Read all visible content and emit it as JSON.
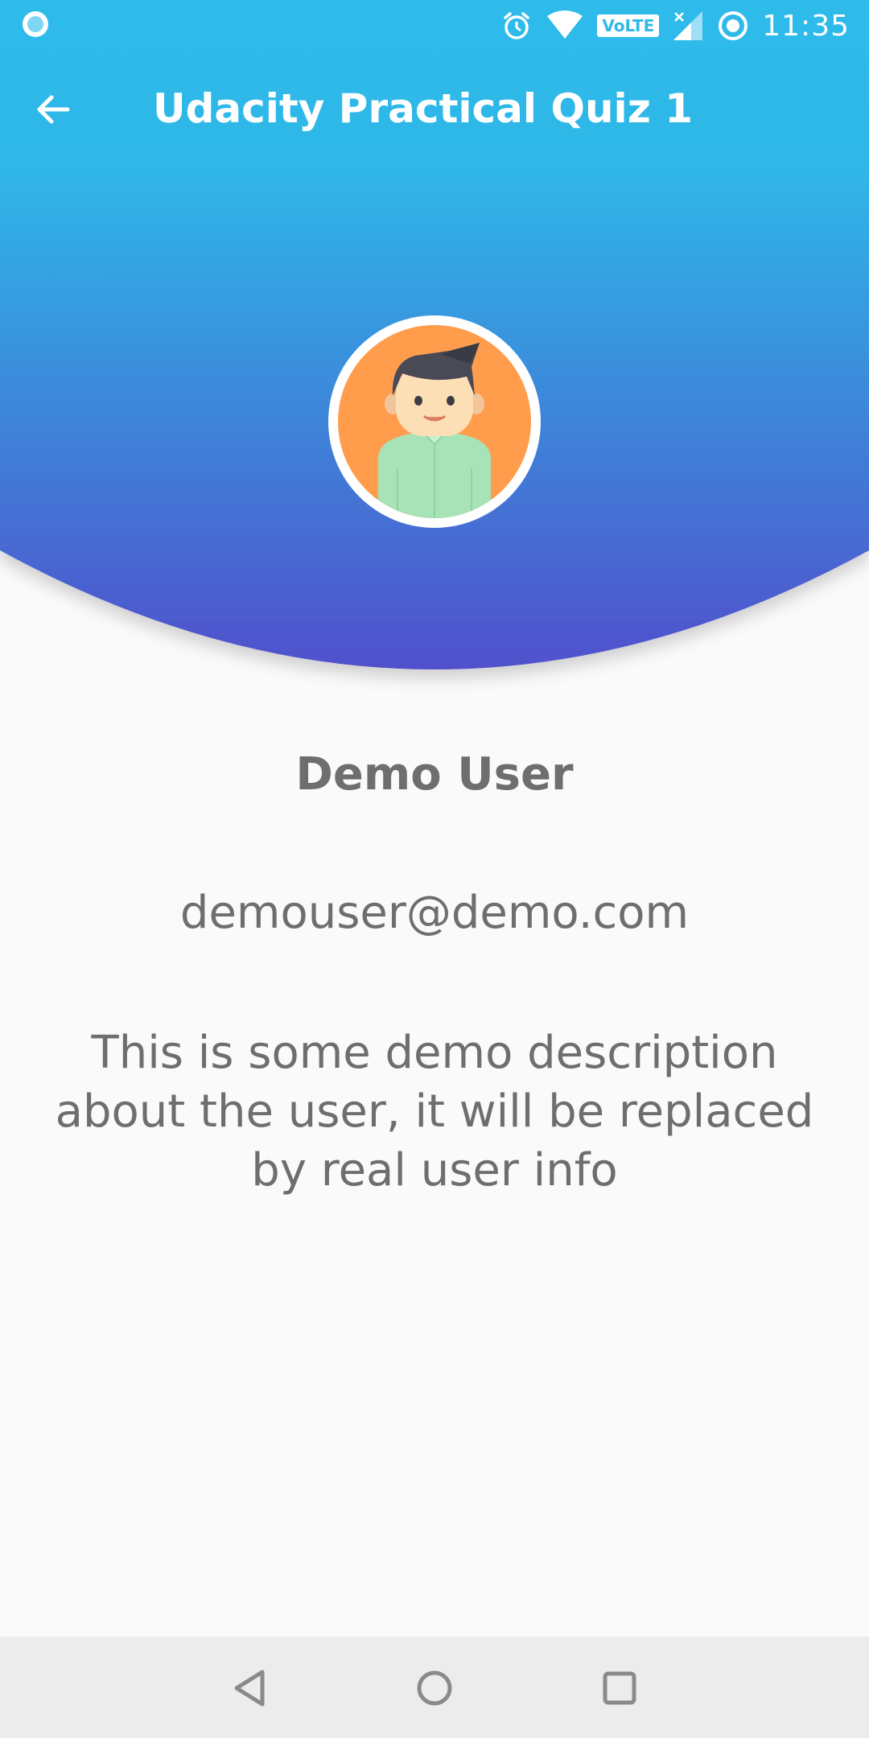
{
  "status_bar": {
    "time": "11:35",
    "volte_label": "VoLTE",
    "icons": [
      "notification-dot-icon",
      "alarm-icon",
      "wifi-icon",
      "signal-icon",
      "sync-icon"
    ]
  },
  "toolbar": {
    "title": "Udacity Practical Quiz 1",
    "back_icon": "arrow-back-icon"
  },
  "profile": {
    "avatar_icon": "user-avatar-icon",
    "name": "Demo User",
    "email": "demouser@demo.com",
    "description": "This is some demo description about the user, it will be replaced by real user info"
  },
  "nav_bar": {
    "buttons": [
      "back-triangle-icon",
      "home-circle-icon",
      "recents-square-icon"
    ]
  },
  "colors": {
    "header_top": "#2ebbea",
    "header_bottom": "#4f56cc",
    "avatar_bg": "#ff9d4d",
    "text_gray": "#6e6e6e",
    "nav_bar_bg": "#ececec"
  }
}
